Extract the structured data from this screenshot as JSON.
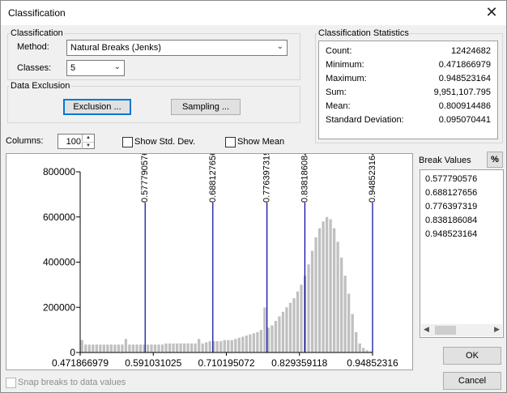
{
  "window": {
    "title": "Classification",
    "close_icon": "close-icon"
  },
  "classification": {
    "group_label": "Classification",
    "method_label": "Method:",
    "method_value": "Natural Breaks (Jenks)",
    "classes_label": "Classes:",
    "classes_value": "5"
  },
  "data_exclusion": {
    "group_label": "Data Exclusion",
    "exclusion_button": "Exclusion ...",
    "sampling_button": "Sampling ..."
  },
  "statistics": {
    "group_label": "Classification Statistics",
    "rows": [
      {
        "label": "Count:",
        "value": "12424682"
      },
      {
        "label": "Minimum:",
        "value": "0.471866979"
      },
      {
        "label": "Maximum:",
        "value": "0.948523164"
      },
      {
        "label": "Sum:",
        "value": "9,951,107.795"
      },
      {
        "label": "Mean:",
        "value": "0.800914486"
      },
      {
        "label": "Standard Deviation:",
        "value": "0.095070441"
      }
    ]
  },
  "controls": {
    "columns_label": "Columns:",
    "columns_value": "100",
    "show_std_dev": "Show Std. Dev.",
    "show_mean": "Show Mean"
  },
  "break_values": {
    "label": "Break Values",
    "percent_button": "%",
    "values": [
      "0.577790576",
      "0.688127656",
      "0.776397319",
      "0.838186084",
      "0.948523164"
    ]
  },
  "buttons": {
    "ok": "OK",
    "cancel": "Cancel"
  },
  "snap": {
    "label": "Snap breaks to data values"
  },
  "chart_data": {
    "type": "bar",
    "y_ticks": [
      "800000",
      "600000",
      "400000",
      "200000",
      "0"
    ],
    "x_ticks": [
      "0.471866979",
      "0.591031025",
      "0.710195072",
      "0.829359118",
      "0.94852316"
    ],
    "x_range": [
      0.471866979,
      0.948523164
    ],
    "ylim": [
      0,
      800000
    ],
    "break_lines": [
      0.577790576,
      0.688127656,
      0.776397319,
      0.838186084,
      0.948523164
    ],
    "break_labels": [
      "0.577790576",
      "0.688127656",
      "0.776397319",
      "0.838186084",
      "0.948523164"
    ],
    "values": [
      55000,
      35000,
      35000,
      35000,
      35000,
      35000,
      35000,
      35000,
      35000,
      35000,
      35000,
      35000,
      60000,
      35000,
      35000,
      35000,
      35000,
      35000,
      35000,
      35000,
      35000,
      35000,
      35000,
      40000,
      40000,
      40000,
      40000,
      40000,
      40000,
      40000,
      40000,
      40000,
      60000,
      40000,
      45000,
      50000,
      50000,
      50000,
      50000,
      55000,
      55000,
      55000,
      60000,
      65000,
      70000,
      75000,
      80000,
      85000,
      90000,
      100000,
      200000,
      110000,
      120000,
      140000,
      160000,
      180000,
      200000,
      220000,
      240000,
      270000,
      300000,
      340000,
      390000,
      450000,
      510000,
      550000,
      580000,
      600000,
      590000,
      550000,
      490000,
      420000,
      340000,
      260000,
      170000,
      90000,
      40000,
      20000,
      10000,
      5000
    ]
  }
}
